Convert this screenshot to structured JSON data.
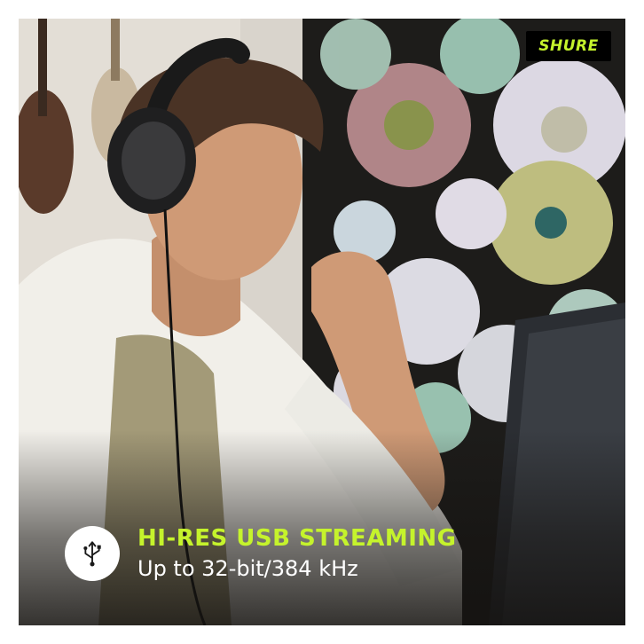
{
  "brand": {
    "logo_text": "SHURE",
    "accent_color": "#c5f32c"
  },
  "photo": {
    "icon": "person-with-headphones-photo"
  },
  "feature": {
    "icon": "usb-icon",
    "title": "HI-RES USB STREAMING",
    "subtitle": "Up to 32-bit/384 kHz"
  }
}
